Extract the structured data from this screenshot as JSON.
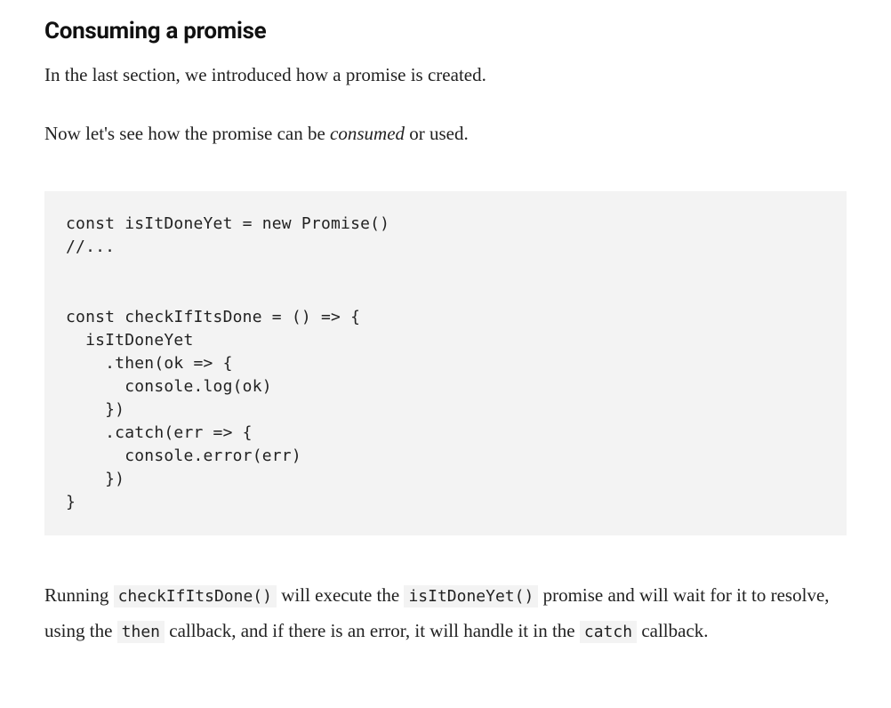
{
  "heading": "Consuming a promise",
  "para1": "In the last section, we introduced how a promise is created.",
  "para2_pre": "Now let's see how the promise can be ",
  "para2_em": "consumed",
  "para2_post": " or used.",
  "code": "const isItDoneYet = new Promise()\n//...\n\n\nconst checkIfItsDone = () => {\n  isItDoneYet\n    .then(ok => {\n      console.log(ok)\n    })\n    .catch(err => {\n      console.error(err)\n    })\n}",
  "para3": {
    "t1": "Running ",
    "c1": "checkIfItsDone()",
    "t2": " will execute the ",
    "c2": "isItDoneYet()",
    "t3": " promise and will wait for it to resolve, using the ",
    "c3": "then",
    "t4": " callback, and if there is an error, it will handle it in the ",
    "c4": "catch",
    "t5": " callback."
  }
}
